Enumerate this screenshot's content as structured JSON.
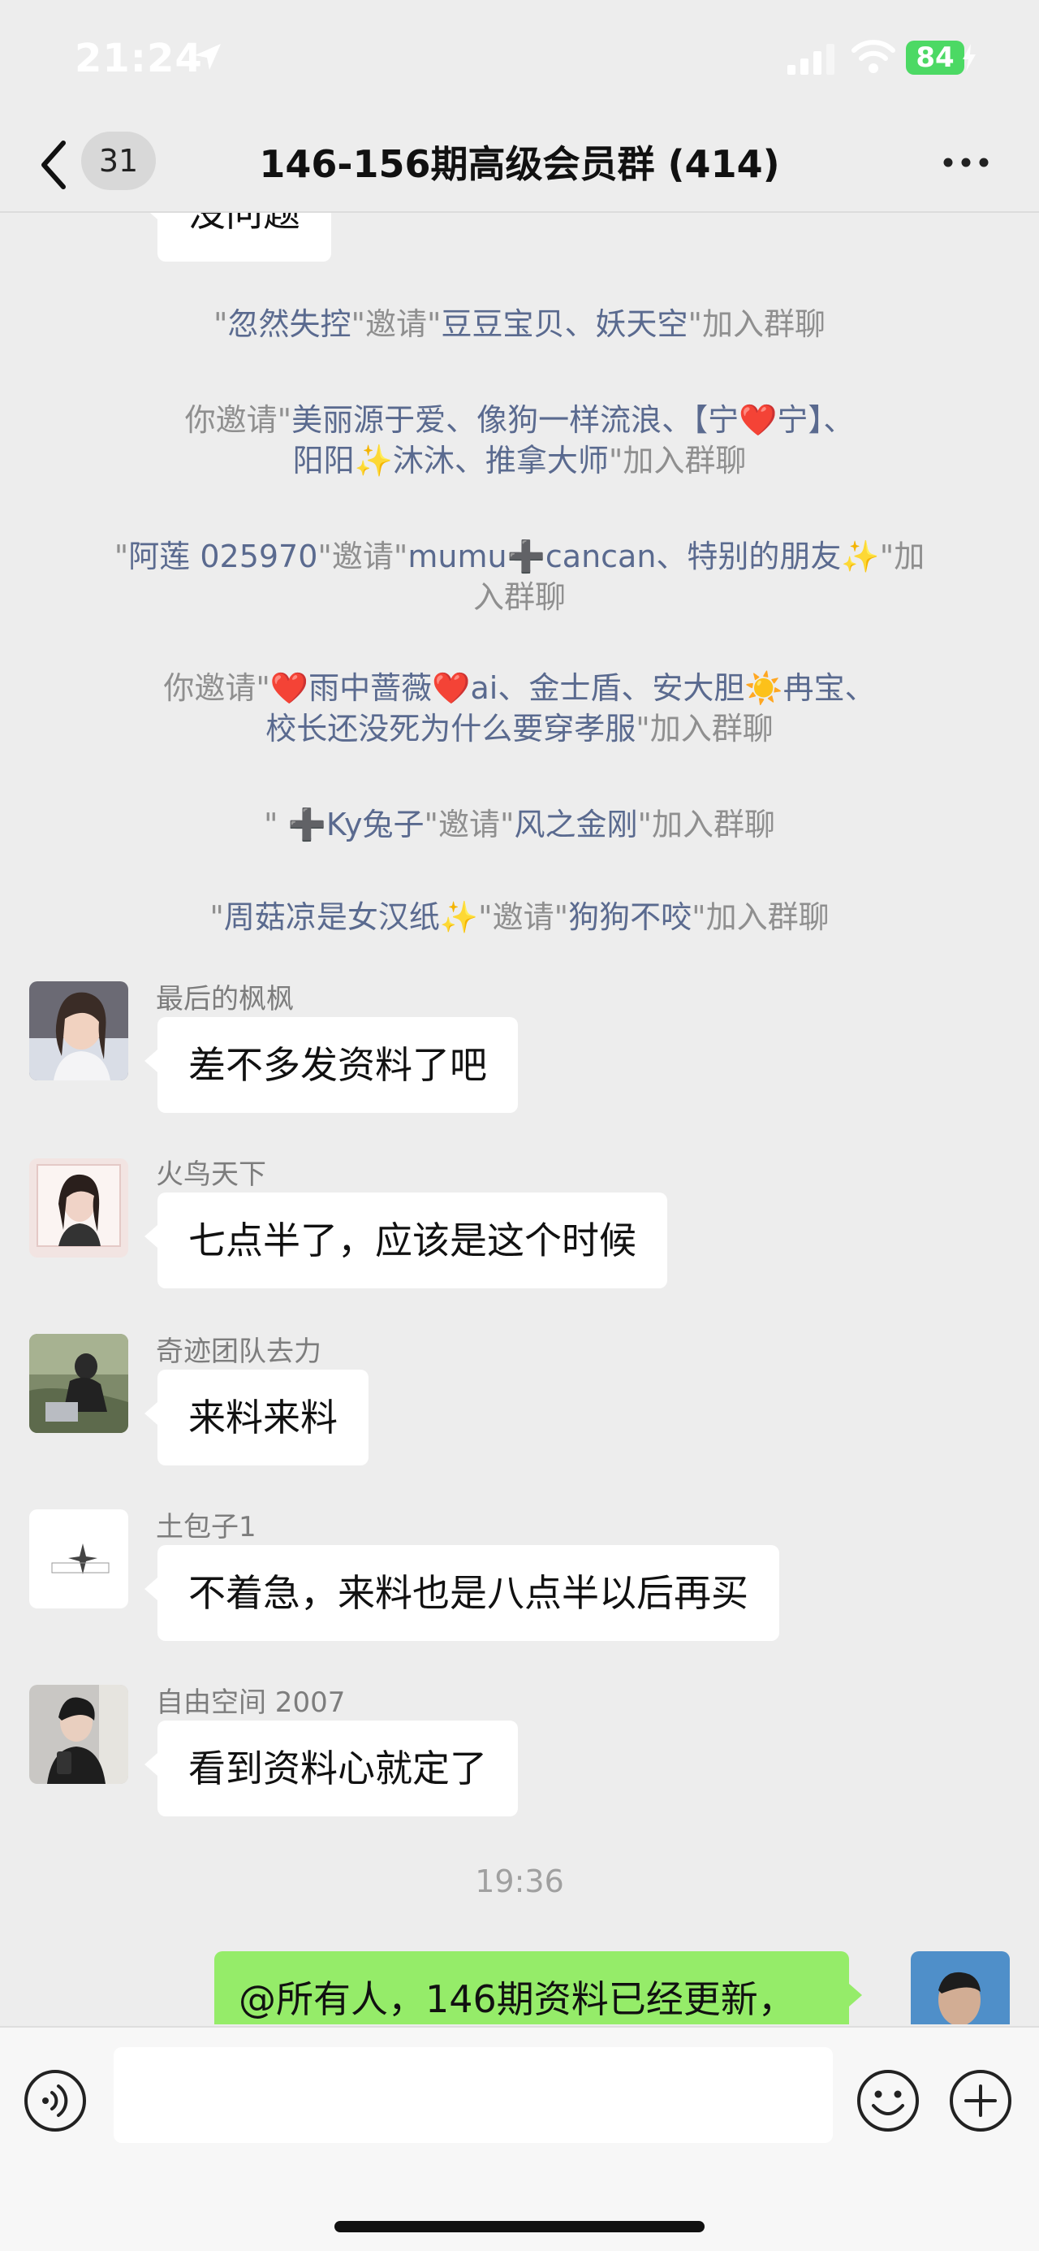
{
  "status": {
    "time": "21:24",
    "battery": "84"
  },
  "nav": {
    "unread": "31",
    "title": "146-156期高级会员群 (414)"
  },
  "top_cut_message": "没问题",
  "system_messages": [
    {
      "pre": "\"",
      "a": "忽然失控",
      "mid": "\"邀请\"",
      "b": "豆豆宝贝、妖天空",
      "post": "\"加入群聊"
    },
    {
      "line1_pre": "你邀请\"",
      "line1_b": "美丽源于爱、像狗一样流浪、【宁❤️宁】、",
      "line2_b": "阳阳✨沐沐、推拿大师",
      "line2_post": "\"加入群聊"
    },
    {
      "line1_pre": "\"",
      "line1_a": "阿莲 025970",
      "line1_mid": "\"邀请\"",
      "line1_b": "mumu➕cancan、特别的朋友✨",
      "line1_post": "\"加",
      "line2_post": "入群聊"
    },
    {
      "line1_pre": "你邀请\"",
      "line1_b": "❤️雨中蔷薇❤️ai、金士盾、安大胆☀️冉宝、",
      "line2_b": "校长还没死为什么要穿孝服",
      "line2_post": "\"加入群聊"
    },
    {
      "pre": "\" ",
      "a": "➕Ky兔子",
      "mid": "\"邀请\"",
      "b": "风之金刚",
      "post": "\"加入群聊"
    },
    {
      "pre": "\"",
      "a": "周菇凉是女汉纸✨",
      "mid": "\"邀请\"",
      "b": "狗狗不咬",
      "post": "\"加入群聊"
    }
  ],
  "messages": [
    {
      "nick": "最后的枫枫",
      "text": "差不多发资料了吧"
    },
    {
      "nick": "火鸟天下",
      "text": "七点半了，应该是这个时候"
    },
    {
      "nick": "奇迹团队去力",
      "text": "来料来料"
    },
    {
      "nick": "土包子1",
      "text": "不着急，来料也是八点半以后再买"
    },
    {
      "nick": "自由空间 2007",
      "text": "看到资料心就定了"
    }
  ],
  "time_separator": "19:36",
  "my_message": "@所有人，146期资料已经更新，",
  "colors": {
    "bubble_mine": "#95ec69",
    "bubble_other": "#ffffff",
    "background": "#ededed"
  }
}
